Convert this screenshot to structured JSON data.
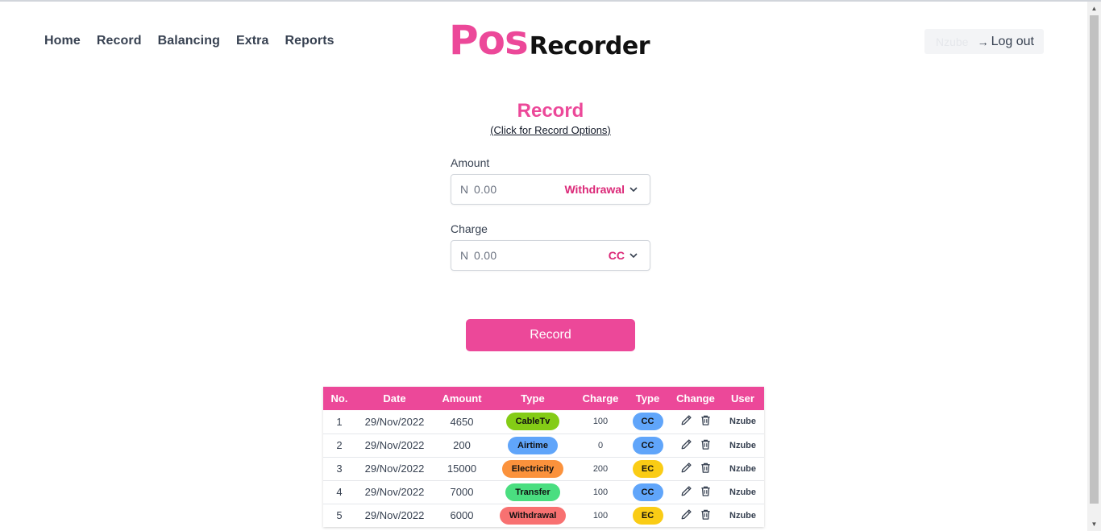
{
  "nav": {
    "items": [
      "Home",
      "Record",
      "Balancing",
      "Extra",
      "Reports"
    ]
  },
  "logo": {
    "part1": "Pos",
    "part2": "Recorder"
  },
  "header": {
    "username": "Nzube",
    "logout_label": "Log out"
  },
  "form": {
    "title": "Record",
    "options_link": "(Click for Record Options)",
    "amount_label": "Amount",
    "amount_currency": "N",
    "amount_value": "0.00",
    "amount_type": "Withdrawal",
    "charge_label": "Charge",
    "charge_currency": "N",
    "charge_value": "0.00",
    "charge_type": "CC",
    "submit_label": "Record"
  },
  "table": {
    "headers": [
      "No.",
      "Date",
      "Amount",
      "Type",
      "Charge",
      "Type",
      "Change",
      "User"
    ],
    "rows": [
      {
        "no": "1",
        "date": "29/Nov/2022",
        "amount": "4650",
        "type": "CableTv",
        "type_color": "#84cc16",
        "charge": "100",
        "ctype": "CC",
        "ctype_color": "#60a5fa",
        "user": "Nzube"
      },
      {
        "no": "2",
        "date": "29/Nov/2022",
        "amount": "200",
        "type": "Airtime",
        "type_color": "#60a5fa",
        "charge": "0",
        "ctype": "CC",
        "ctype_color": "#60a5fa",
        "user": "Nzube"
      },
      {
        "no": "3",
        "date": "29/Nov/2022",
        "amount": "15000",
        "type": "Electricity",
        "type_color": "#fb923c",
        "charge": "200",
        "ctype": "EC",
        "ctype_color": "#facc15",
        "user": "Nzube"
      },
      {
        "no": "4",
        "date": "29/Nov/2022",
        "amount": "7000",
        "type": "Transfer",
        "type_color": "#4ade80",
        "charge": "100",
        "ctype": "CC",
        "ctype_color": "#60a5fa",
        "user": "Nzube"
      },
      {
        "no": "5",
        "date": "29/Nov/2022",
        "amount": "6000",
        "type": "Withdrawal",
        "type_color": "#f87171",
        "charge": "100",
        "ctype": "EC",
        "ctype_color": "#facc15",
        "user": "Nzube"
      }
    ]
  },
  "colors": {
    "accent": "#ec4899"
  },
  "icons": {
    "edit": "pencil-icon",
    "delete": "trash-icon",
    "dropdown": "chevron-down-icon",
    "logout": "arrow-right-icon"
  }
}
